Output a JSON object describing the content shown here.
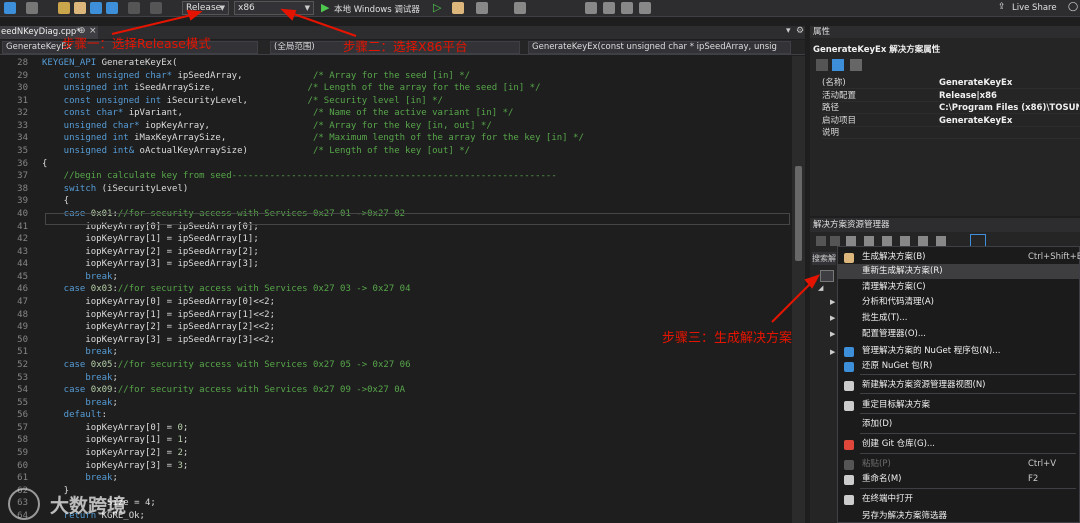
{
  "toolbar": {
    "config": "Release",
    "platform": "x86",
    "run_label": "本地 Windows 调试器",
    "live_share": "Live Share"
  },
  "tab": {
    "file": "eedNKeyDiag.cpp*",
    "pin": "⊕",
    "close": "×"
  },
  "nav": {
    "project": "GenerateKeyEx",
    "scope": "(全局范围)",
    "function": "GenerateKeyEx(const unsigned char * ipSeedArray, unsig"
  },
  "code": [
    {
      "n": "28",
      "segs": [
        {
          "c": "kw",
          "t": "KEYGEN_API "
        },
        {
          "c": "id",
          "t": "GenerateKeyEx("
        }
      ]
    },
    {
      "n": "29",
      "segs": [
        {
          "c": "kw",
          "t": "    const unsigned char* "
        },
        {
          "c": "id",
          "t": "ipSeedArray,             "
        },
        {
          "c": "cm",
          "t": "/* Array for the seed [in] */"
        }
      ]
    },
    {
      "n": "30",
      "segs": [
        {
          "c": "kw",
          "t": "    unsigned int "
        },
        {
          "c": "id",
          "t": "iSeedArraySize,                 "
        },
        {
          "c": "cm",
          "t": "/* Length of the array for the seed [in] */"
        }
      ]
    },
    {
      "n": "31",
      "segs": [
        {
          "c": "kw",
          "t": "    const unsigned int "
        },
        {
          "c": "id",
          "t": "iSecurityLevel,           "
        },
        {
          "c": "cm",
          "t": "/* Security level [in] */"
        }
      ]
    },
    {
      "n": "32",
      "segs": [
        {
          "c": "kw",
          "t": "    const char* "
        },
        {
          "c": "id",
          "t": "ipVariant,                        "
        },
        {
          "c": "cm",
          "t": "/* Name of the active variant [in] */"
        }
      ]
    },
    {
      "n": "33",
      "segs": [
        {
          "c": "kw",
          "t": "    unsigned char* "
        },
        {
          "c": "id",
          "t": "iopKeyArray,                   "
        },
        {
          "c": "cm",
          "t": "/* Array for the key [in, out] */"
        }
      ]
    },
    {
      "n": "34",
      "segs": [
        {
          "c": "kw",
          "t": "    unsigned int "
        },
        {
          "c": "id",
          "t": "iMaxKeyArraySize,                "
        },
        {
          "c": "cm",
          "t": "/* Maximum length of the array for the key [in] */"
        }
      ]
    },
    {
      "n": "35",
      "segs": [
        {
          "c": "kw",
          "t": "    unsigned int& "
        },
        {
          "c": "id",
          "t": "oActualKeyArraySize)            "
        },
        {
          "c": "cm",
          "t": "/* Length of the key [out] */"
        }
      ]
    },
    {
      "n": "36",
      "segs": [
        {
          "c": "id",
          "t": "{"
        }
      ]
    },
    {
      "n": "37",
      "segs": [
        {
          "c": "cm",
          "t": "    //begin calculate key from seed------------------------------------------------------------"
        }
      ]
    },
    {
      "n": "38",
      "segs": [
        {
          "c": "kw",
          "t": "    switch "
        },
        {
          "c": "id",
          "t": "(iSecurityLevel)"
        }
      ]
    },
    {
      "n": "39",
      "segs": [
        {
          "c": "id",
          "t": "    {"
        }
      ]
    },
    {
      "n": "40",
      "segs": [
        {
          "c": "kw",
          "t": "    case "
        },
        {
          "c": "num",
          "t": "0x01"
        },
        {
          "c": "id",
          "t": ":"
        },
        {
          "c": "cm",
          "t": "//for security access with Services 0x27 01 ->0x27 02"
        }
      ]
    },
    {
      "n": "41",
      "segs": [
        {
          "c": "id",
          "t": "        iopKeyArray[0] = ipSeedArray[0];"
        }
      ]
    },
    {
      "n": "42",
      "segs": [
        {
          "c": "id",
          "t": "        iopKeyArray[1] = ipSeedArray[1];"
        }
      ]
    },
    {
      "n": "43",
      "segs": [
        {
          "c": "id",
          "t": "        iopKeyArray[2] = ipSeedArray[2];"
        }
      ]
    },
    {
      "n": "44",
      "segs": [
        {
          "c": "id",
          "t": "        iopKeyArray[3] = ipSeedArray[3];"
        }
      ]
    },
    {
      "n": "45",
      "segs": [
        {
          "c": "kw",
          "t": "        break"
        },
        {
          "c": "id",
          "t": ";"
        }
      ]
    },
    {
      "n": "46",
      "segs": [
        {
          "c": "kw",
          "t": "    case "
        },
        {
          "c": "num",
          "t": "0x03"
        },
        {
          "c": "id",
          "t": ":"
        },
        {
          "c": "cm",
          "t": "//for security access with Services 0x27 03 -> 0x27 04"
        }
      ]
    },
    {
      "n": "47",
      "segs": [
        {
          "c": "id",
          "t": "        iopKeyArray[0] = ipSeedArray[0]<<2;"
        }
      ]
    },
    {
      "n": "48",
      "segs": [
        {
          "c": "id",
          "t": "        iopKeyArray[1] = ipSeedArray[1]<<2;"
        }
      ]
    },
    {
      "n": "49",
      "segs": [
        {
          "c": "id",
          "t": "        iopKeyArray[2] = ipSeedArray[2]<<2;"
        }
      ]
    },
    {
      "n": "50",
      "segs": [
        {
          "c": "id",
          "t": "        iopKeyArray[3] = ipSeedArray[3]<<2;"
        }
      ]
    },
    {
      "n": "51",
      "segs": [
        {
          "c": "kw",
          "t": "        break"
        },
        {
          "c": "id",
          "t": ";"
        }
      ]
    },
    {
      "n": "52",
      "segs": [
        {
          "c": "kw",
          "t": "    case "
        },
        {
          "c": "num",
          "t": "0x05"
        },
        {
          "c": "id",
          "t": ":"
        },
        {
          "c": "cm",
          "t": "//for security access with Services 0x27 05 -> 0x27 06"
        }
      ]
    },
    {
      "n": "53",
      "segs": [
        {
          "c": "kw",
          "t": "        break"
        },
        {
          "c": "id",
          "t": ";"
        }
      ]
    },
    {
      "n": "54",
      "segs": [
        {
          "c": "kw",
          "t": "    case "
        },
        {
          "c": "num",
          "t": "0x09"
        },
        {
          "c": "id",
          "t": ":"
        },
        {
          "c": "cm",
          "t": "//for security access with Services 0x27 09 ->0x27 0A"
        }
      ]
    },
    {
      "n": "55",
      "segs": [
        {
          "c": "kw",
          "t": "        break"
        },
        {
          "c": "id",
          "t": ";"
        }
      ]
    },
    {
      "n": "56",
      "segs": [
        {
          "c": "kw",
          "t": "    default"
        },
        {
          "c": "id",
          "t": ":"
        }
      ]
    },
    {
      "n": "57",
      "segs": [
        {
          "c": "id",
          "t": "        iopKeyArray[0] = "
        },
        {
          "c": "num",
          "t": "0"
        },
        {
          "c": "id",
          "t": ";"
        }
      ]
    },
    {
      "n": "58",
      "segs": [
        {
          "c": "id",
          "t": "        iopKeyArray[1] = "
        },
        {
          "c": "num",
          "t": "1"
        },
        {
          "c": "id",
          "t": ";"
        }
      ]
    },
    {
      "n": "59",
      "segs": [
        {
          "c": "id",
          "t": "        iopKeyArray[2] = "
        },
        {
          "c": "num",
          "t": "2"
        },
        {
          "c": "id",
          "t": ";"
        }
      ]
    },
    {
      "n": "60",
      "segs": [
        {
          "c": "id",
          "t": "        iopKeyArray[3] = "
        },
        {
          "c": "num",
          "t": "3"
        },
        {
          "c": "id",
          "t": ";"
        }
      ]
    },
    {
      "n": "61",
      "segs": [
        {
          "c": "kw",
          "t": "        break"
        },
        {
          "c": "id",
          "t": ";"
        }
      ]
    },
    {
      "n": "62",
      "segs": [
        {
          "c": "id",
          "t": "    }"
        }
      ]
    },
    {
      "n": "63",
      "segs": [
        {
          "c": "id",
          "t": "            Size = 4;"
        }
      ]
    },
    {
      "n": "64",
      "segs": [
        {
          "c": "kw",
          "t": "    return "
        },
        {
          "c": "id",
          "t": "KGRE_Ok;"
        }
      ]
    }
  ],
  "properties": {
    "title": "属性",
    "subject": "GenerateKeyEx  解决方案属性",
    "rows": [
      {
        "k": "(名称)",
        "v": "GenerateKeyEx"
      },
      {
        "k": "活动配置",
        "v": "Release|x86"
      },
      {
        "k": "路径",
        "v": "C:\\Program Files (x86)\\TOSUN\\"
      },
      {
        "k": "启动项目",
        "v": "GenerateKeyEx"
      },
      {
        "k": "说明",
        "v": ""
      }
    ]
  },
  "solution_explorer": {
    "title": "解决方案资源管理器",
    "search": "搜索解"
  },
  "context_menu": [
    {
      "label": "生成解决方案(B)",
      "shortcut": "Ctrl+Shift+B",
      "icon": "build-icon",
      "color": "#dcb67a"
    },
    {
      "label": "重新生成解决方案(R)",
      "shortcut": "",
      "icon": "",
      "color": "",
      "selected": true
    },
    {
      "label": "清理解决方案(C)",
      "shortcut": "",
      "icon": "",
      "color": ""
    },
    {
      "label": "分析和代码清理(A)",
      "shortcut": "",
      "icon": "",
      "color": ""
    },
    {
      "label": "批生成(T)...",
      "shortcut": "",
      "icon": "",
      "color": ""
    },
    {
      "label": "配置管理器(O)...",
      "shortcut": "",
      "icon": "",
      "color": ""
    },
    {
      "label": "管理解决方案的 NuGet 程序包(N)...",
      "shortcut": "",
      "icon": "nuget-icon",
      "color": "#3c8fd8"
    },
    {
      "label": "还原 NuGet 包(R)",
      "shortcut": "",
      "icon": "restore-icon",
      "color": "#3c8fd8"
    },
    {
      "label": "新建解决方案资源管理器视图(N)",
      "shortcut": "",
      "icon": "new-view-icon",
      "color": "#cccccc"
    },
    {
      "label": "重定目标解决方案",
      "shortcut": "",
      "icon": "retarget-icon",
      "color": "#cccccc"
    },
    {
      "label": "添加(D)",
      "shortcut": "",
      "icon": "",
      "color": ""
    },
    {
      "label": "创建 Git 仓库(G)...",
      "shortcut": "",
      "icon": "git-icon",
      "color": "#e0473b"
    },
    {
      "label": "粘贴(P)",
      "shortcut": "Ctrl+V",
      "icon": "paste-icon",
      "color": "#555555",
      "disabled": true
    },
    {
      "label": "重命名(M)",
      "shortcut": "F2",
      "icon": "rename-icon",
      "color": "#cccccc"
    },
    {
      "label": "在终端中打开",
      "shortcut": "",
      "icon": "terminal-icon",
      "color": "#cccccc"
    },
    {
      "label": "另存为解决方案筛选器",
      "shortcut": "",
      "icon": "",
      "color": ""
    }
  ],
  "annotations": {
    "step1": "步骤一：选择Release模式",
    "step2": "步骤二：选择X86平台",
    "step3": "步骤三：生成解决方案",
    "watermark": "大数跨境",
    "annot_color": "#e51400"
  }
}
